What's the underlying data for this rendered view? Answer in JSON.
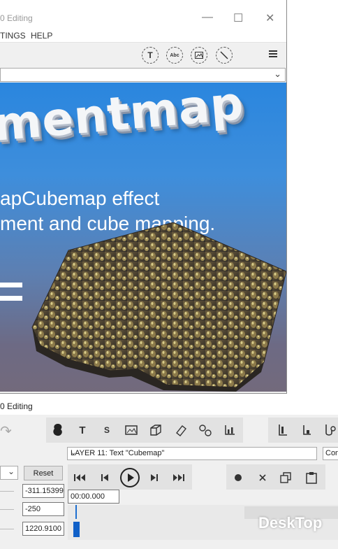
{
  "top_window": {
    "title": "0 Editing",
    "controls": {
      "minimize": "—",
      "maximize": "☐",
      "close": "✕"
    },
    "menu": [
      "TINGS",
      "HELP"
    ],
    "toolbar_icons": [
      "text-tool-icon",
      "abc-text-icon",
      "image-tool-icon",
      "slash-tool-icon",
      "hamburger-menu-icon"
    ],
    "toolbar_labels": {
      "text": "T",
      "abc": "Abc"
    },
    "combo_arrow": "⌄"
  },
  "preview": {
    "heading": "mentmap",
    "line1": "apCubemap effect",
    "line2": "ment and cube mapping."
  },
  "bottom_window": {
    "title": "0 Editing",
    "tool_labels": {
      "text": "T",
      "subtitle": "S"
    },
    "layer_select": "LAYER 11: Text \"Cubemap\"",
    "con_select": "Con",
    "reset_label": "Reset",
    "field1": "-311.15399",
    "field2": "-250",
    "field3": "1220.9100",
    "timecode": "00:00.000"
  },
  "watermark": "DeskTop",
  "colors": {
    "preview_top": "#2a86de",
    "preview_bottom": "#736a7c",
    "playhead": "#1060c8"
  }
}
